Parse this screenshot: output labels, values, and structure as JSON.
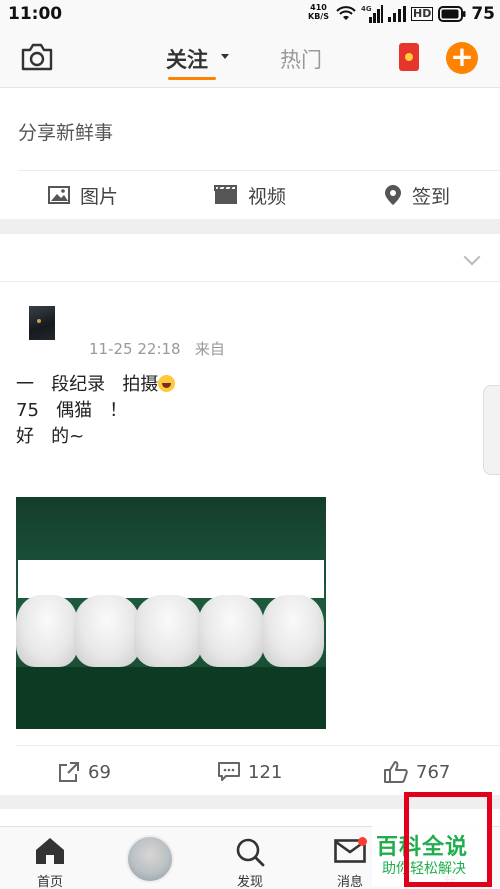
{
  "status_bar": {
    "time": "11:00",
    "net_speed": "410",
    "net_unit": "KB/S",
    "signal_tag": "4G",
    "hd": "HD",
    "battery": "75"
  },
  "top_nav": {
    "tab_follow": "关注",
    "tab_hot": "热门"
  },
  "compose": {
    "placeholder": "分享新鲜事",
    "picture": "图片",
    "video": "视频",
    "checkin": "签到"
  },
  "post": {
    "time": "11-25 22:18",
    "source": "来自",
    "lines": [
      "一   段纪录   拍摄",
      "75   偶猫   ！",
      "好   的~"
    ],
    "reposts": "69",
    "comments": "121",
    "likes": "767"
  },
  "tab_bar": {
    "home": "首页",
    "discover": "发现",
    "messages": "消息",
    "me": "我"
  },
  "watermark": {
    "title": "百科全说",
    "subtitle": "助你轻松解决"
  },
  "colors": {
    "accent": "#ff8200",
    "watermark": "#1fae4b",
    "highlight": "#e0001b"
  }
}
